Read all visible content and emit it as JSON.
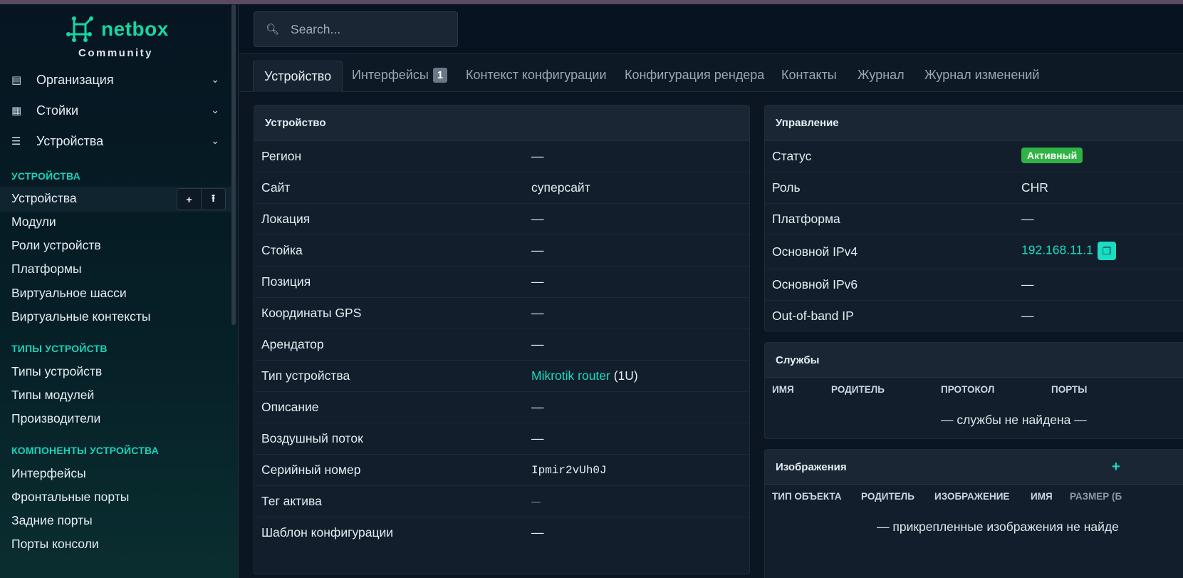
{
  "brand": {
    "name": "netbox",
    "edition": "Community",
    "accent": "#16d6a6"
  },
  "sidebar": {
    "top_menus": [
      {
        "label": "Организация",
        "icon": "organization-icon"
      },
      {
        "label": "Стойки",
        "icon": "rack-icon"
      },
      {
        "label": "Устройства",
        "icon": "devices-icon"
      }
    ],
    "sections": [
      {
        "title": "УСТРОЙСТВА",
        "items": [
          "Устройства",
          "Модули",
          "Роли устройств",
          "Платформы",
          "Виртуальное шасси",
          "Виртуальные контексты"
        ]
      },
      {
        "title": "ТИПЫ УСТРОЙСТВ",
        "items": [
          "Типы устройств",
          "Типы модулей",
          "Производители"
        ]
      },
      {
        "title": "КОМПОНЕНТЫ УСТРОЙСТВА",
        "items": [
          "Интерфейсы",
          "Фронтальные порты",
          "Задние порты",
          "Порты консоли"
        ]
      }
    ],
    "active_item": "Устройства",
    "add_icon": "+",
    "import_icon": "⭱"
  },
  "search": {
    "placeholder": "Search..."
  },
  "tabs": [
    {
      "label": "Устройство",
      "active": true
    },
    {
      "label": "Интерфейсы",
      "badge": "1"
    },
    {
      "label": "Контекст конфигурации"
    },
    {
      "label": "Конфигурация рендера"
    },
    {
      "label": "Контакты"
    },
    {
      "label": "Журнал"
    },
    {
      "label": "Журнал изменений"
    }
  ],
  "device_card": {
    "title": "Устройство",
    "rows": [
      {
        "label": "Регион",
        "value": "—"
      },
      {
        "label": "Сайт",
        "value": "суперсайт"
      },
      {
        "label": "Локация",
        "value": "—"
      },
      {
        "label": "Стойка",
        "value": "—"
      },
      {
        "label": "Позиция",
        "value": "—"
      },
      {
        "label": "Координаты GPS",
        "value": "—"
      },
      {
        "label": "Арендатор",
        "value": "—"
      },
      {
        "label": "Тип устройства",
        "value": "Mikrotik router",
        "suffix": "(1U)"
      },
      {
        "label": "Описание",
        "value": "—"
      },
      {
        "label": "Воздушный поток",
        "value": "—"
      },
      {
        "label": "Серийный номер",
        "value": "Ipmir2vUh0J"
      },
      {
        "label": "Тег актива",
        "value": "—"
      },
      {
        "label": "Шаблон конфигурации",
        "value": "—"
      }
    ]
  },
  "management_card": {
    "title": "Управление",
    "rows": [
      {
        "label": "Статус",
        "value": "Активный"
      },
      {
        "label": "Роль",
        "value": "CHR"
      },
      {
        "label": "Платформа",
        "value": "—"
      },
      {
        "label": "Основной IPv4",
        "value": "192.168.11.1"
      },
      {
        "label": "Основной IPv6",
        "value": "—"
      },
      {
        "label": "Out-of-band IP",
        "value": "—"
      }
    ],
    "status_color": "#2fb344"
  },
  "services_card": {
    "title": "Службы",
    "columns": [
      "ИМЯ",
      "РОДИТЕЛЬ",
      "ПРОТОКОЛ",
      "ПОРТЫ"
    ],
    "empty": "— службы не найдена —"
  },
  "images_card": {
    "title": "Изображения",
    "add": "+",
    "columns": [
      "ТИП ОБЪЕКТА",
      "РОДИТЕЛЬ",
      "ИЗОБРАЖЕНИЕ",
      "ИМЯ",
      "РАЗМЕР (Б"
    ],
    "empty": "— прикрепленные изображения не найде"
  }
}
